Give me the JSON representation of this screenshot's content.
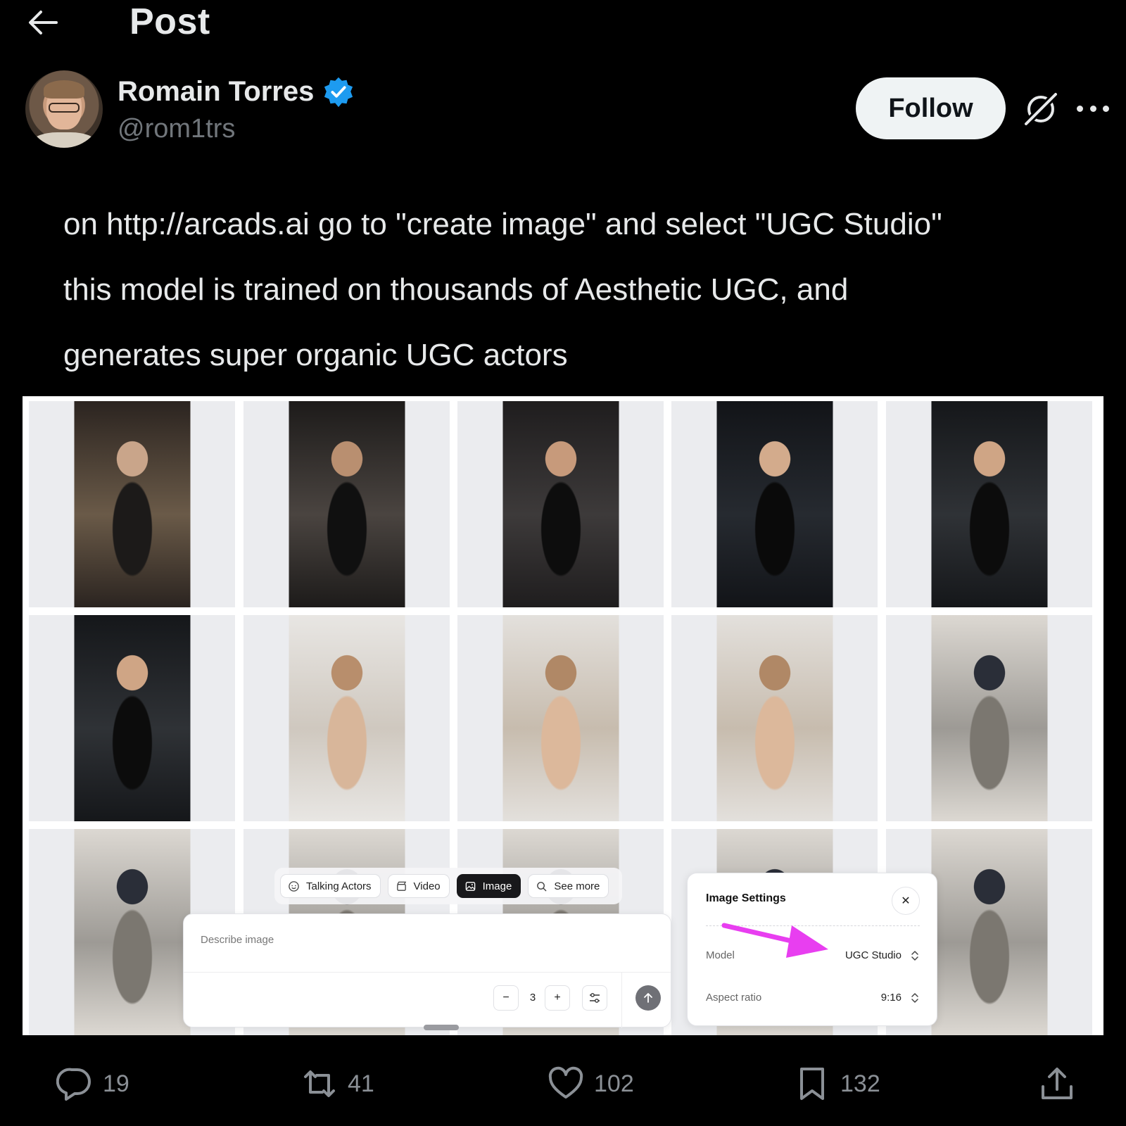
{
  "header": {
    "title": "Post"
  },
  "author": {
    "name": "Romain Torres",
    "handle": "@rom1trs",
    "follow_label": "Follow"
  },
  "post": {
    "lines": [
      "on http://arcads.ai go to \"create image\" and select \"UGC Studio\"",
      "this model is trained on thousands of Aesthetic UGC, and",
      "generates super organic UGC actors"
    ]
  },
  "app": {
    "tabs": [
      {
        "label": "Talking Actors",
        "icon": "sparkle-face-icon"
      },
      {
        "label": "Video",
        "icon": "clapper-icon"
      },
      {
        "label": "Image",
        "icon": "image-icon",
        "active": true
      },
      {
        "label": "See more",
        "icon": "search-icon"
      }
    ],
    "prompt": {
      "placeholder": "Describe image",
      "value": ""
    },
    "count": {
      "minus": "−",
      "value": "3",
      "plus": "+"
    },
    "settings": {
      "title": "Image Settings",
      "close": "✕",
      "model_label": "Model",
      "model_value": "UGC Studio",
      "aspect_label": "Aspect ratio",
      "aspect_value": "9:16"
    }
  },
  "actions": {
    "replies": "19",
    "reposts": "41",
    "likes": "102",
    "bookmarks": "132"
  },
  "colors": {
    "background": "#000000",
    "text": "#e7e9ea",
    "muted": "#71767b",
    "verified": "#1d9bf0",
    "annotation_arrow": "#e83ef0"
  }
}
